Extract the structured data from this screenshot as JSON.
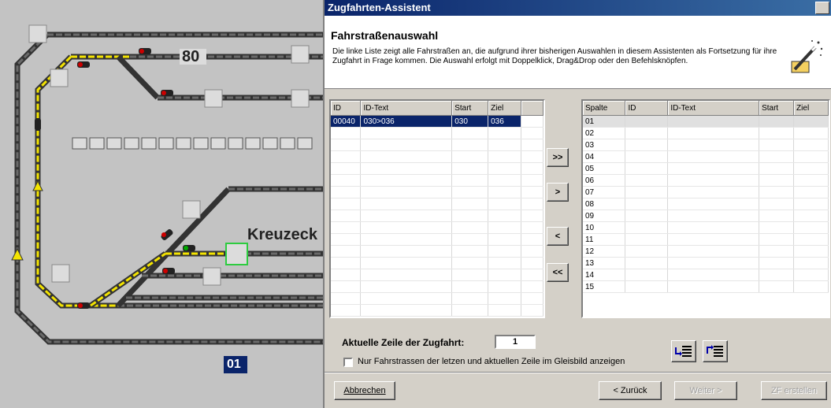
{
  "track": {
    "signal_number": "80",
    "station_name": "Kreuzeck",
    "track_label": "01",
    "colors": {
      "track": "#555555",
      "route": "#f4e400",
      "occupied": "#222222",
      "highlight": "#2ecc40"
    }
  },
  "dialog": {
    "title": "Zugfahrten-Assistent",
    "heading": "Fahrstraßenauswahl",
    "description": "Die linke Liste zeigt alle Fahrstraßen an, die aufgrund ihrer bisherigen Auswahlen in diesem Assistenten als Fortsetzung für ihre Zugfahrt in Frage kommen. Die Auswahl erfolgt mit Doppelklick, Drag&Drop oder den Befehlsknöpfen.",
    "left_list": {
      "columns": [
        "ID",
        "ID-Text",
        "Start",
        "Ziel"
      ],
      "rows": [
        {
          "id": "00040",
          "text": "030>036",
          "start": "030",
          "ziel": "036"
        }
      ]
    },
    "right_list": {
      "columns": [
        "Spalte",
        "ID",
        "ID-Text",
        "Start",
        "Ziel"
      ],
      "rows": [
        "01",
        "02",
        "03",
        "04",
        "05",
        "06",
        "07",
        "08",
        "09",
        "10",
        "11",
        "12",
        "13",
        "14",
        "15"
      ]
    },
    "transfer_buttons": {
      "add_all": ">>",
      "add": ">",
      "remove": "<",
      "remove_all": "<<"
    },
    "current_row_label": "Aktuelle Zeile der Zugfahrt:",
    "current_row_value": "1",
    "checkbox_label": "Nur Fahrstrassen der letzen und aktuellen Zeile im Gleisbild anzeigen",
    "footer": {
      "cancel": "Abbrechen",
      "back": "< Zurück",
      "next": "Weiter >",
      "finish": "ZF erstellen"
    }
  }
}
